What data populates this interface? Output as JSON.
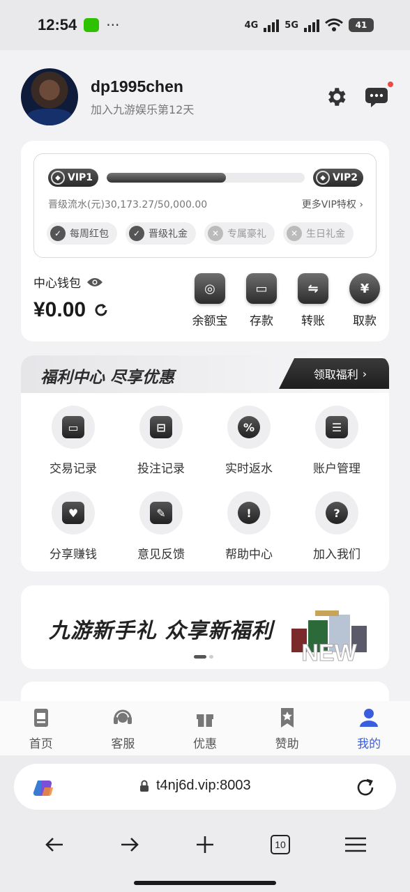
{
  "status_bar": {
    "time": "12:54",
    "dots": "···",
    "net1": "4G",
    "net2": "5G",
    "battery": "41"
  },
  "header": {
    "username": "dp1995chen",
    "join_text": "加入九游娱乐第12天"
  },
  "vip": {
    "current": "VIP1",
    "next": "VIP2",
    "progress": 0.603,
    "flow_text": "晋级流水(元)30,173.27/50,000.00",
    "more": "更多VIP特权",
    "perks": [
      {
        "label": "每周红包",
        "unlocked": true
      },
      {
        "label": "晋级礼金",
        "unlocked": true
      },
      {
        "label": "专属豪礼",
        "unlocked": false
      },
      {
        "label": "生日礼金",
        "unlocked": false
      }
    ]
  },
  "wallet": {
    "title": "中心钱包",
    "amount": "¥0.00",
    "actions": [
      {
        "label": "余额宝",
        "icon": "vault-icon"
      },
      {
        "label": "存款",
        "icon": "wallet-icon"
      },
      {
        "label": "转账",
        "icon": "transfer-icon"
      },
      {
        "label": "取款",
        "icon": "withdraw-yen-icon"
      }
    ]
  },
  "welfare": {
    "title": "福利中心 尽享优惠",
    "button": "领取福利",
    "items": [
      {
        "label": "交易记录",
        "icon": "wallet-record-icon"
      },
      {
        "label": "投注记录",
        "icon": "calendar-icon"
      },
      {
        "label": "实时返水",
        "icon": "percent-badge-icon"
      },
      {
        "label": "账户管理",
        "icon": "id-card-icon"
      },
      {
        "label": "分享赚钱",
        "icon": "handshake-heart-icon"
      },
      {
        "label": "意见反馈",
        "icon": "edit-note-icon"
      },
      {
        "label": "帮助中心",
        "icon": "alert-circle-icon"
      },
      {
        "label": "加入我们",
        "icon": "question-icon"
      }
    ]
  },
  "banner": {
    "text": "九游新手礼 众享新福利",
    "art_text": "NEW"
  },
  "tabbar": [
    {
      "label": "首页",
      "icon": "home-doc-icon",
      "active": false
    },
    {
      "label": "客服",
      "icon": "headset-icon",
      "active": false
    },
    {
      "label": "优惠",
      "icon": "gift-icon",
      "active": false
    },
    {
      "label": "赞助",
      "icon": "bookmark-star-icon",
      "active": false
    },
    {
      "label": "我的",
      "icon": "person-icon",
      "active": true
    }
  ],
  "browser": {
    "url": "t4nj6d.vip:8003",
    "tab_count": "10"
  },
  "colors": {
    "accent": "#3a5de0",
    "dark": "#2c2c2c",
    "notify": "#e94a4a"
  }
}
